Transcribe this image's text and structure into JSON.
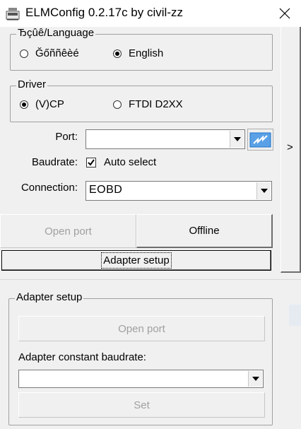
{
  "window": {
    "title": "ELMConfig 0.2.17c by civil-zz"
  },
  "language_group": {
    "label": "Ђçûê/Language",
    "option_local": "Ğőññêèé",
    "option_english": "English",
    "selected": "English"
  },
  "driver_group": {
    "label": "Driver",
    "option_vcp": "(V)CP",
    "option_ftdi": "FTDI D2XX",
    "selected": "(V)CP"
  },
  "port": {
    "label": "Port:",
    "value": ""
  },
  "baudrate": {
    "label": "Baudrate:",
    "auto_select_label": "Auto select",
    "auto_select_checked": true
  },
  "connection": {
    "label": "Connection:",
    "value": "EOBD"
  },
  "buttons": {
    "open_port": "Open port",
    "offline": "Offline",
    "adapter_setup": "Adapter setup"
  },
  "side_expander": {
    "symbol": ">"
  },
  "adapter_setup_group": {
    "label": "Adapter setup",
    "open_port": "Open port",
    "constant_baudrate_label": "Adapter constant baudrate:",
    "constant_baudrate_value": "",
    "set": "Set"
  },
  "colors": {
    "accent_refresh": "#1e73c8",
    "disabled_text": "#a0a0a0"
  }
}
